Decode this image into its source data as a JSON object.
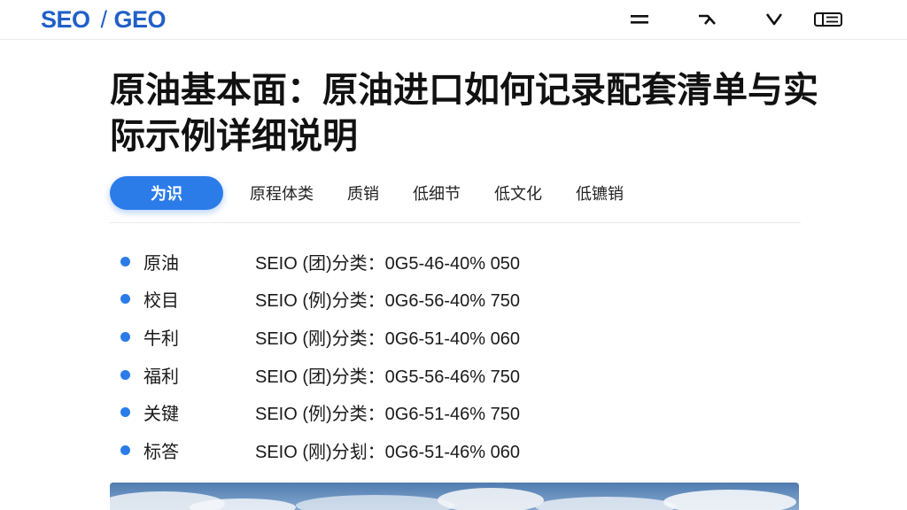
{
  "header": {
    "logo_left": "SEO",
    "logo_sep": "/",
    "logo_right": "GEO",
    "icons": [
      "menu-icon",
      "share-icon",
      "collapse-icon",
      "reader-mode-icon"
    ]
  },
  "article": {
    "title": "原油基本面：原油进口如何记录配套清单与实际示例详细说明"
  },
  "tabs": [
    {
      "label": "为识",
      "active": true
    },
    {
      "label": "原程体类",
      "active": false
    },
    {
      "label": "质销",
      "active": false
    },
    {
      "label": "低细节",
      "active": false
    },
    {
      "label": "低文化",
      "active": false
    },
    {
      "label": "低镳销",
      "active": false
    }
  ],
  "list": [
    {
      "name": "原油",
      "value": "SEIO (团)分类：0G5-46-40% 050"
    },
    {
      "name": "校目",
      "value": "SEIO (例)分类：0G6-56-40% 750"
    },
    {
      "name": "牛利",
      "value": "SEIO (刚)分类：0G6-51-40% 060"
    },
    {
      "name": "福利",
      "value": "SEIO (团)分类：0G5-56-46% 750"
    },
    {
      "name": "关键",
      "value": "SEIO (例)分类：0G6-51-46% 750"
    },
    {
      "name": "标答",
      "value": "SEIO (刚)分刬：0G6-51-46% 060"
    }
  ],
  "colors": {
    "brand": "#1f5fc8",
    "accent": "#2b7ce9",
    "text": "#111111"
  }
}
